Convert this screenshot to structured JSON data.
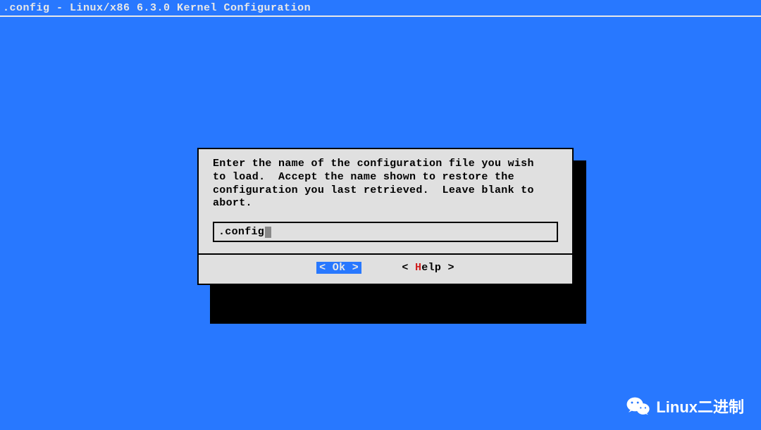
{
  "title_bar": ".config - Linux/x86 6.3.0 Kernel Configuration",
  "dialog": {
    "message": "Enter the name of the configuration file you wish\nto load.  Accept the name shown to restore the\nconfiguration you last retrieved.  Leave blank to\nabort.",
    "input_value": ".config",
    "buttons": {
      "ok": {
        "bracket_open": "<",
        "spacer": "  ",
        "hotkey": "O",
        "rest": "k",
        "bracket_close": ">"
      },
      "help": {
        "bracket_open": "<",
        "hotkey": "H",
        "rest": "elp",
        "bracket_close": ">"
      }
    }
  },
  "watermark": {
    "text": "Linux二进制"
  }
}
